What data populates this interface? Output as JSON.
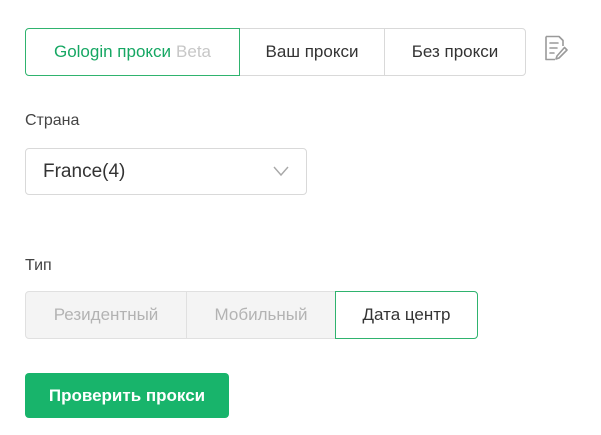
{
  "proxy_source": {
    "tabs": [
      {
        "label": "Gologin прокси",
        "badge": "Beta",
        "selected": true
      },
      {
        "label": "Ваш прокси",
        "selected": false
      },
      {
        "label": "Без прокси",
        "selected": false
      }
    ],
    "edit_icon": "edit-note-icon"
  },
  "country": {
    "label": "Страна",
    "value": "France(4)",
    "icon": "chevron-down-icon"
  },
  "type": {
    "label": "Тип",
    "options": [
      {
        "label": "Резидентный",
        "selected": false
      },
      {
        "label": "Мобильный",
        "selected": false
      },
      {
        "label": "Дата центр",
        "selected": true
      }
    ]
  },
  "check_button": {
    "label": "Проверить прокси"
  },
  "colors": {
    "accent": "#18b46b",
    "accent_border": "#2fb36e",
    "accent_text": "#16a763",
    "disabled_bg": "#f4f4f4",
    "disabled_text": "#b3b3b3"
  }
}
